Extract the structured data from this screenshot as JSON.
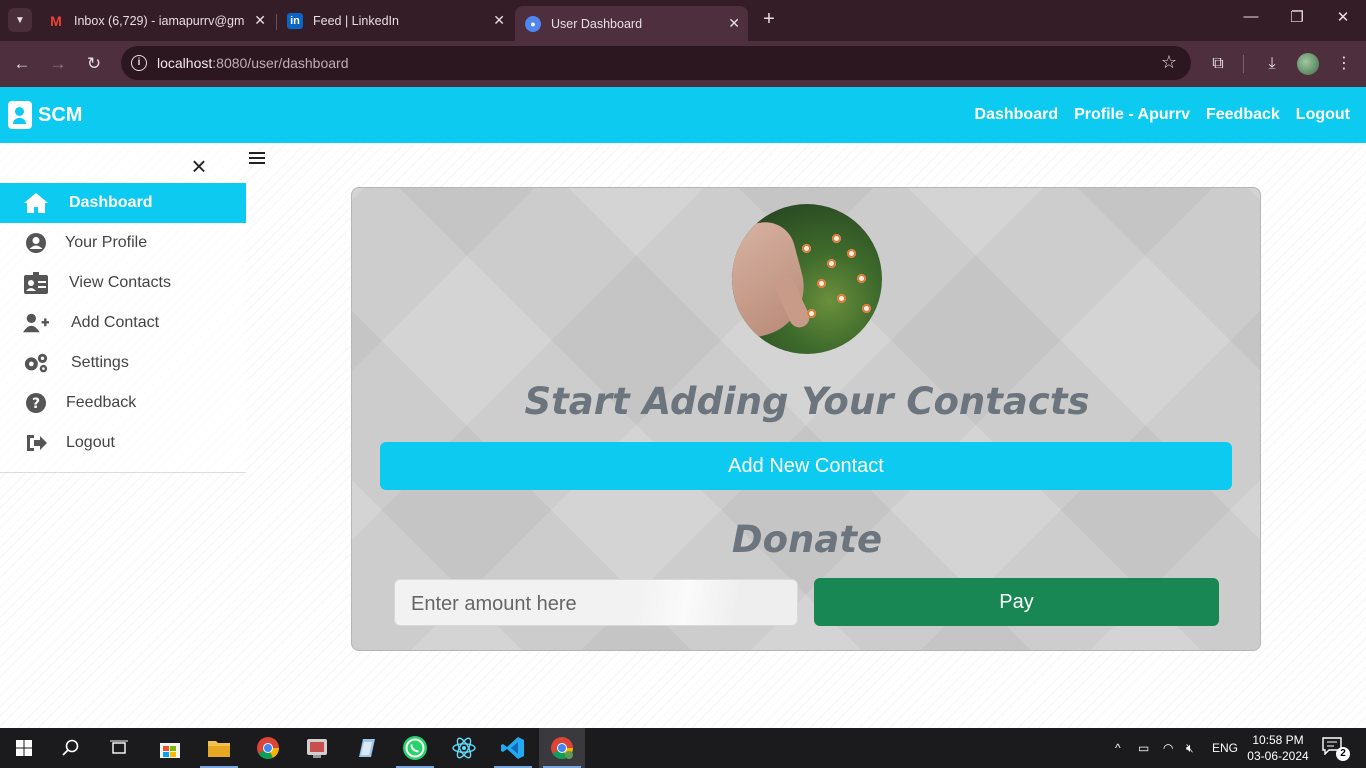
{
  "browser": {
    "tabs": [
      {
        "title": "Inbox (6,729) - iamapurrv@gma",
        "favicon": "gmail-icon"
      },
      {
        "title": "Feed | LinkedIn",
        "favicon": "linkedin-icon"
      },
      {
        "title": "User Dashboard",
        "favicon": "user-icon",
        "active": true
      }
    ],
    "url_host": "localhost",
    "url_rest": ":8080/user/dashboard"
  },
  "navbar": {
    "brand": "SCM",
    "links": [
      "Dashboard",
      "Profile - Apurrv",
      "Feedback",
      "Logout"
    ],
    "color": "#0dcaf0"
  },
  "sidebar": {
    "items": [
      {
        "label": "Dashboard",
        "icon": "home-icon",
        "active": true
      },
      {
        "label": "Your Profile",
        "icon": "user-circle-icon"
      },
      {
        "label": "View Contacts",
        "icon": "id-badge-icon"
      },
      {
        "label": "Add Contact",
        "icon": "user-plus-icon"
      },
      {
        "label": "Settings",
        "icon": "gears-icon"
      },
      {
        "label": "Feedback",
        "icon": "question-circle-icon"
      },
      {
        "label": "Logout",
        "icon": "sign-out-icon"
      }
    ]
  },
  "main": {
    "heading": "Start Adding Your Contacts",
    "add_button": "Add New Contact",
    "donate_heading": "Donate",
    "amount_placeholder": "Enter amount here",
    "pay_button": "Pay",
    "pay_color": "#198754"
  },
  "taskbar": {
    "language": "ENG",
    "time": "10:58 PM",
    "date": "03-06-2024",
    "notifications": "2"
  }
}
